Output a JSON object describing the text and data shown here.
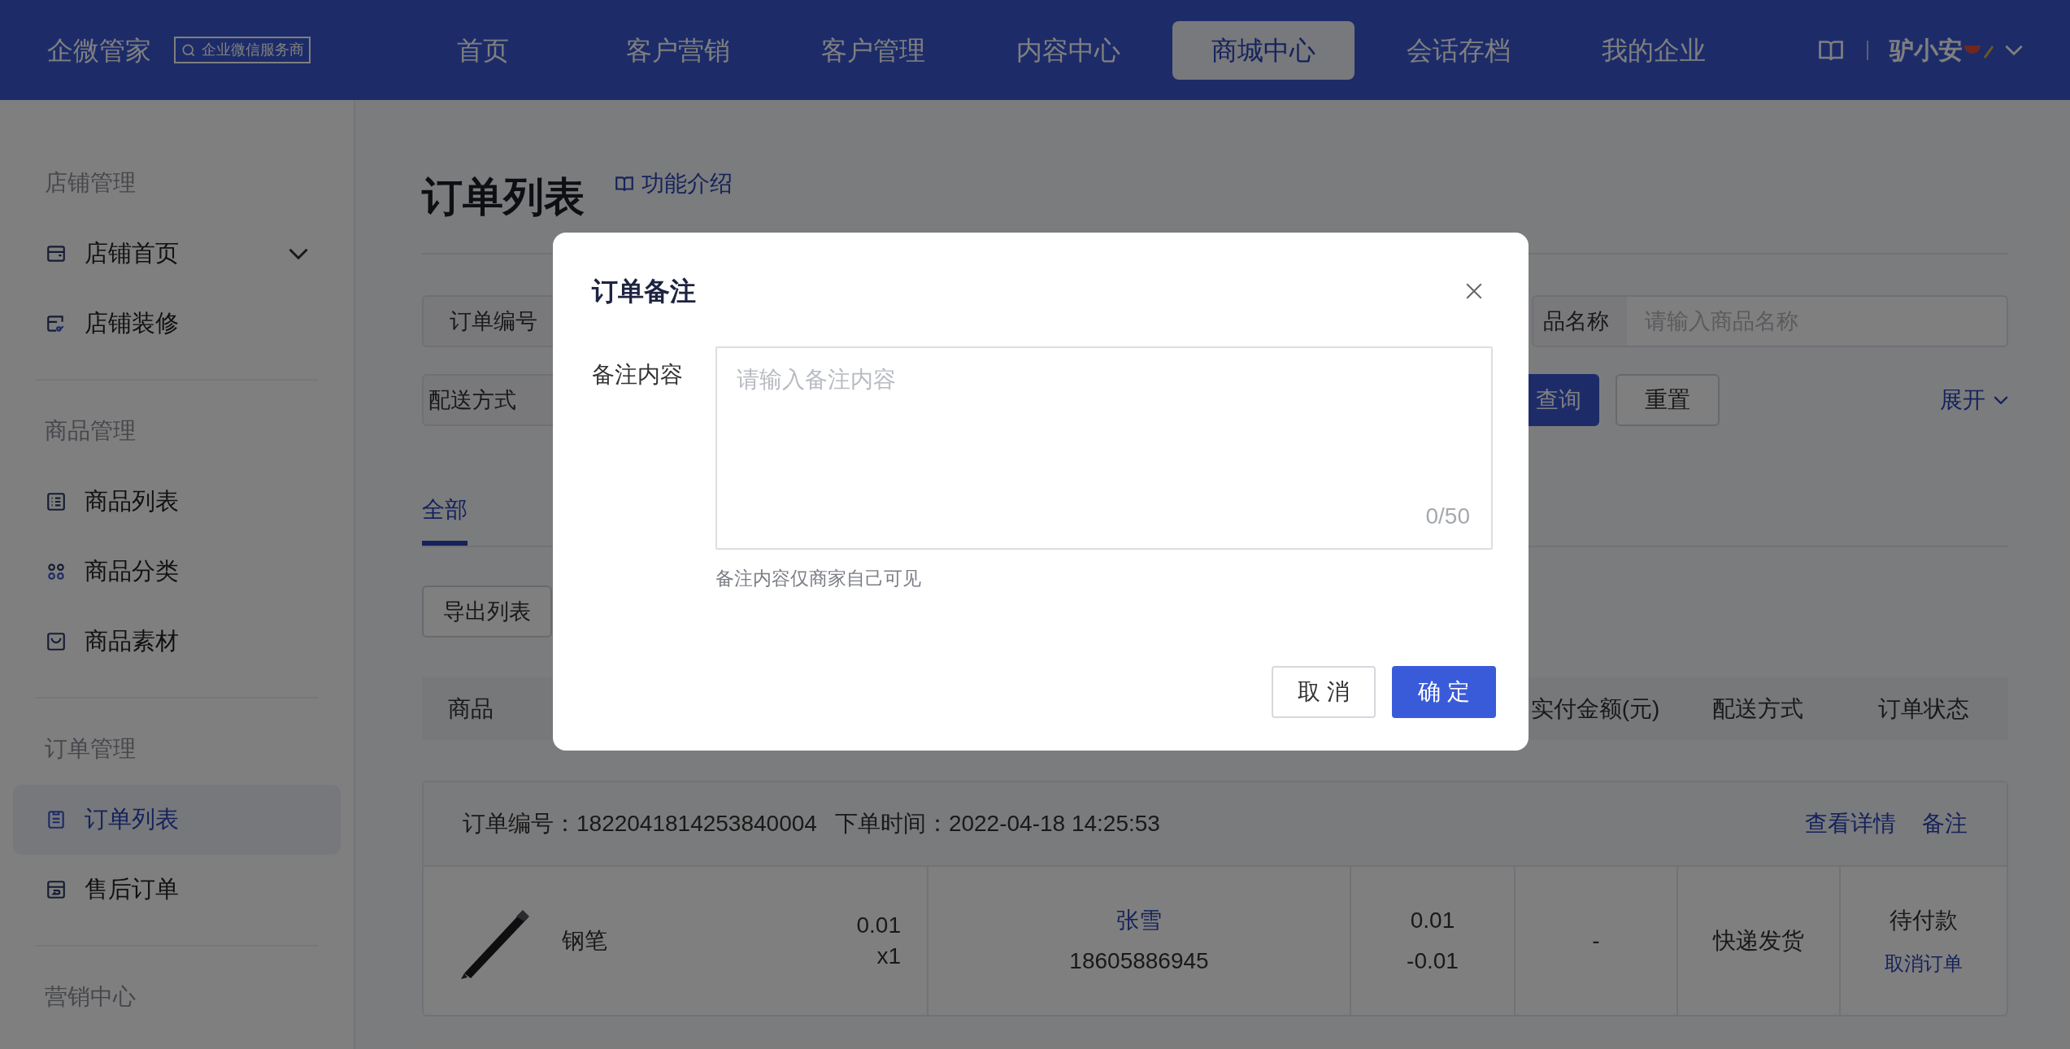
{
  "top_nav": {
    "brand": "企微管家",
    "badge": "企业微信服务商",
    "items": [
      {
        "label": "首页",
        "selected": false
      },
      {
        "label": "客户营销",
        "selected": false
      },
      {
        "label": "客户管理",
        "selected": false
      },
      {
        "label": "内容中心",
        "selected": false
      },
      {
        "label": "商城中心",
        "selected": true
      },
      {
        "label": "会话存档",
        "selected": false
      },
      {
        "label": "我的企业",
        "selected": false
      }
    ],
    "user": "驴小安"
  },
  "sidebar": {
    "sections": [
      {
        "title": "店铺管理",
        "items": [
          {
            "label": "店铺首页",
            "selected": false,
            "collapsible": true
          },
          {
            "label": "店铺装修",
            "selected": false,
            "collapsible": false
          }
        ]
      },
      {
        "title": "商品管理",
        "items": [
          {
            "label": "商品列表",
            "selected": false,
            "collapsible": false
          },
          {
            "label": "商品分类",
            "selected": false,
            "collapsible": false
          },
          {
            "label": "商品素材",
            "selected": false,
            "collapsible": false
          }
        ]
      },
      {
        "title": "订单管理",
        "items": [
          {
            "label": "订单列表",
            "selected": true,
            "collapsible": false
          },
          {
            "label": "售后订单",
            "selected": false,
            "collapsible": false
          }
        ]
      },
      {
        "title": "营销中心"
      }
    ]
  },
  "main": {
    "title": "订单列表",
    "help_link": "功能介绍",
    "filters": {
      "order_no": {
        "label": "订单编号"
      },
      "product_name": {
        "label": "品名称",
        "placeholder": "请输入商品名称"
      },
      "delivery": {
        "label": "配送方式"
      },
      "search_button": "查询",
      "reset_button": "重置",
      "expand_link": "展开"
    },
    "tabs": [
      {
        "label": "全部",
        "selected": true
      }
    ],
    "export_button": "导出列表",
    "table": {
      "columns": [
        "商品",
        "实付金额(元)",
        "配送方式",
        "订单状态"
      ],
      "rows": [
        {
          "order_no": "订单编号：1822041814253840004",
          "order_time": "下单时间：2022-04-18 14:25:53",
          "actions": [
            "查看详情",
            "备注"
          ],
          "product": "钢笔",
          "price": "0.01",
          "quantity": "x1",
          "buyer": "张雪",
          "phone": "18605886945",
          "amount": "0.01",
          "discount": "-0.01",
          "column_5": "-",
          "delivery": "快递发货",
          "status": "待付款",
          "status_action": "取消订单"
        }
      ]
    }
  },
  "dialog": {
    "title": "订单备注",
    "field_label": "备注内容",
    "placeholder": "请输入备注内容",
    "counter": "0/50",
    "hint": "备注内容仅商家自己可见",
    "buttons": [
      {
        "label": "取 消",
        "kind": "secondary"
      },
      {
        "label": "确 定",
        "kind": "primary"
      }
    ]
  }
}
